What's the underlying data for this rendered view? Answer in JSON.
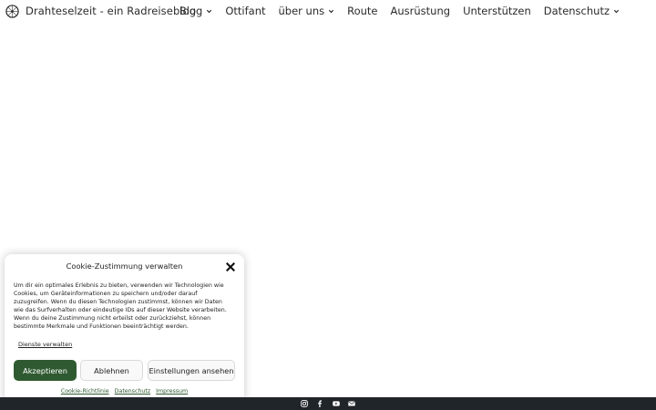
{
  "header": {
    "site_title": "Drahteselzeit - ein Radreiseblog",
    "nav": [
      {
        "label": "Blog",
        "has_dropdown": true
      },
      {
        "label": "Ottifant",
        "has_dropdown": false
      },
      {
        "label": "über uns",
        "has_dropdown": true
      },
      {
        "label": "Route",
        "has_dropdown": false
      },
      {
        "label": "Ausrüstung",
        "has_dropdown": false
      },
      {
        "label": "Unterstützen",
        "has_dropdown": false
      },
      {
        "label": "Datenschutz",
        "has_dropdown": true
      }
    ]
  },
  "cookie": {
    "title": "Cookie-Zustimmung verwalten",
    "text": "Um dir ein optimales Erlebnis zu bieten, verwenden wir Technologien wie Cookies, um Geräteinformationen zu speichern und/oder darauf zuzugreifen. Wenn du diesen Technologien zustimmst, können wir Daten wie das Surfverhalten oder eindeutige IDs auf dieser Website verarbeiten. Wenn du deine Zustimmung nicht erteilst oder zurückziehst, können bestimmte Merkmale und Funktionen beeinträchtigt werden.",
    "manage_services": "Dienste verwalten",
    "accept_label": "Akzeptieren",
    "deny_label": "Ablehnen",
    "settings_label": "Einstellungen ansehen",
    "footer_links": [
      "Cookie-Richtlinie",
      "Datenschutz",
      "Impressum"
    ],
    "accent_color": "#2f5a31"
  },
  "footer": {
    "background_color": "#20252a",
    "social_icons": [
      "instagram-icon",
      "facebook-icon",
      "youtube-icon",
      "email-icon"
    ]
  }
}
